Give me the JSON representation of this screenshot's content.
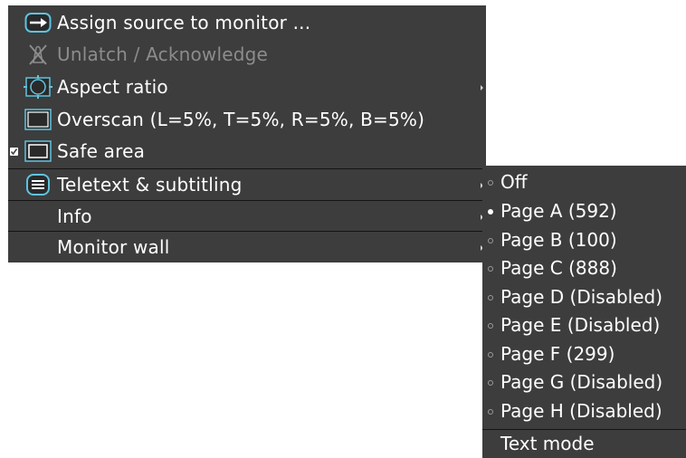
{
  "main_menu": {
    "items": [
      {
        "label": "Assign source to monitor ...",
        "icon": "assign-source-icon",
        "enabled": true,
        "checked": false,
        "submenu": false
      },
      {
        "label": "Unlatch / Acknowledge",
        "icon": "unlatch-icon",
        "enabled": false,
        "checked": false,
        "submenu": false
      },
      {
        "label": "Aspect ratio",
        "icon": "aspect-ratio-icon",
        "enabled": true,
        "checked": false,
        "submenu": true
      },
      {
        "label": "Overscan (L=5%, T=5%, R=5%, B=5%)",
        "icon": "overscan-icon",
        "enabled": true,
        "checked": false,
        "submenu": false
      },
      {
        "label": "Safe area",
        "icon": "safe-area-icon",
        "enabled": true,
        "checked": true,
        "submenu": false
      },
      {
        "label": "Teletext & subtitling",
        "icon": "teletext-icon",
        "enabled": true,
        "checked": false,
        "submenu": true
      },
      {
        "label": "Info",
        "icon": "",
        "enabled": true,
        "checked": false,
        "submenu": true
      },
      {
        "label": "Monitor wall",
        "icon": "",
        "enabled": true,
        "checked": false,
        "submenu": true
      }
    ]
  },
  "sub_menu": {
    "items": [
      {
        "label": "Off",
        "selected": false
      },
      {
        "label": "Page A (592)",
        "selected": true
      },
      {
        "label": "Page B (100)",
        "selected": false
      },
      {
        "label": "Page C (888)",
        "selected": false
      },
      {
        "label": "Page D (Disabled)",
        "selected": false
      },
      {
        "label": "Page E (Disabled)",
        "selected": false
      },
      {
        "label": "Page F (299)",
        "selected": false
      },
      {
        "label": "Page G (Disabled)",
        "selected": false
      },
      {
        "label": "Page H (Disabled)",
        "selected": false
      }
    ],
    "text_mode_label": "Text mode"
  },
  "colors": {
    "menu_background": "#3d3d3d",
    "text": "#ffffff",
    "disabled_text": "#8c8c8c",
    "icon_accent": "#5fc3e0"
  }
}
